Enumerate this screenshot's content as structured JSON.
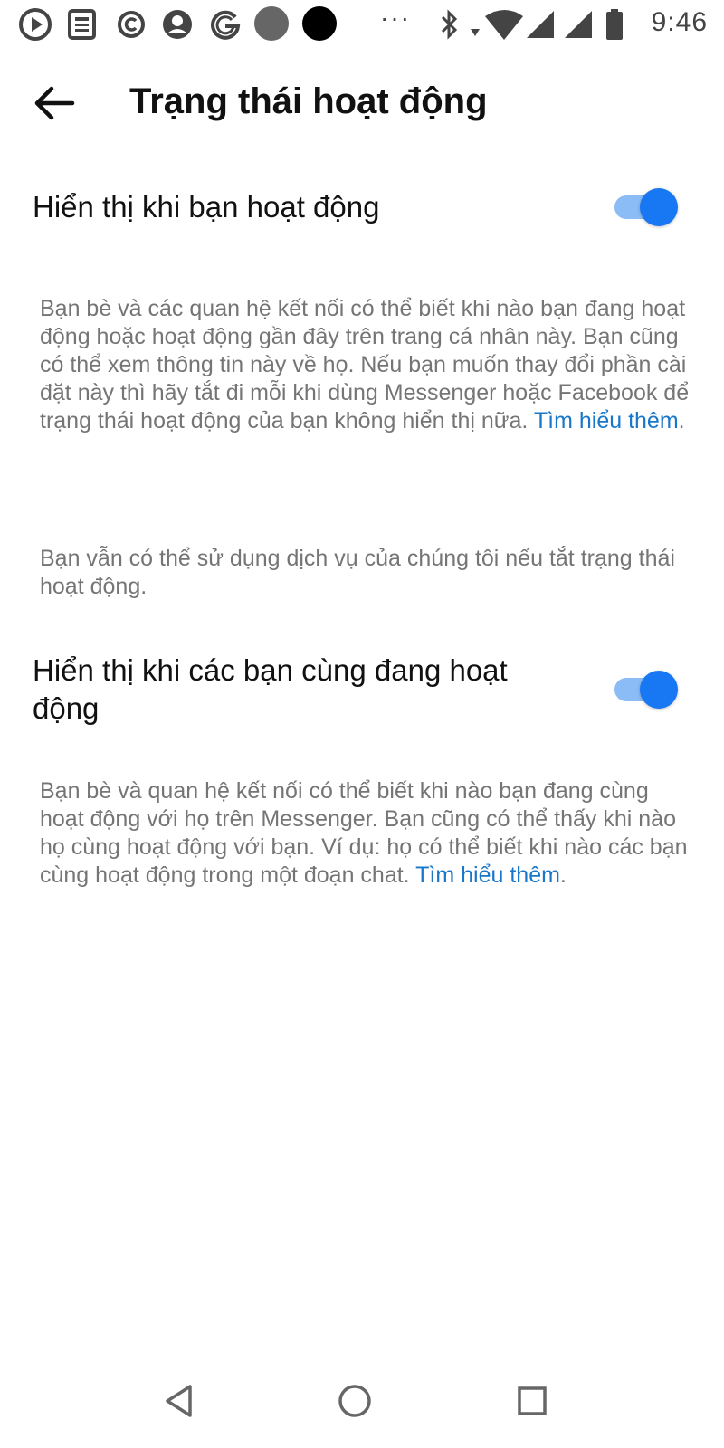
{
  "status_bar": {
    "time": "9:46",
    "dots": "···",
    "icons": [
      "play-circle-icon",
      "news-icon",
      "copyright-icon",
      "account-circle-icon",
      "google-g-icon",
      "gray-dot-icon",
      "black-dot-icon",
      "bluetooth-icon",
      "wifi-icon",
      "signal-icon",
      "signal-icon",
      "battery-icon"
    ]
  },
  "app_bar": {
    "title": "Trạng thái hoạt động",
    "back_icon": "arrow-back-icon"
  },
  "settings": [
    {
      "label": "Hiển thị khi bạn hoạt động",
      "enabled": true,
      "description": "Bạn bè và các quan hệ kết nối có thể biết khi nào bạn đang hoạt động hoặc hoạt động gần đây trên trang cá nhân này. Bạn cũng có thể xem thông tin này về họ. Nếu bạn muốn thay đổi phần cài đặt này thì hãy tắt đi mỗi khi dùng Messenger hoặc Facebook để trạng thái hoạt động của bạn không hiển thị nữa.",
      "link": "Tìm hiểu thêm",
      "link_suffix": ".",
      "note": "Bạn vẫn có thể sử dụng dịch vụ của chúng tôi nếu tắt trạng thái hoạt động."
    },
    {
      "label": "Hiển thị khi các bạn cùng đang hoạt động",
      "enabled": true,
      "description": "Bạn bè và quan hệ kết nối có thể biết khi nào bạn đang cùng hoạt động với họ trên Messenger. Bạn cũng có thể thấy khi nào họ cùng hoạt động với bạn. Ví dụ: họ có thể biết khi nào các bạn cùng hoạt động trong một đoạn chat.",
      "link": "Tìm hiểu thêm",
      "link_suffix": "."
    }
  ],
  "nav_bar": {
    "buttons": [
      "back-triangle-icon",
      "home-circle-icon",
      "recents-square-icon"
    ]
  },
  "colors": {
    "accent": "#1877f2",
    "toggle_track": "#8bbcf6",
    "link": "#1877c9",
    "secondary_text": "#757575"
  }
}
